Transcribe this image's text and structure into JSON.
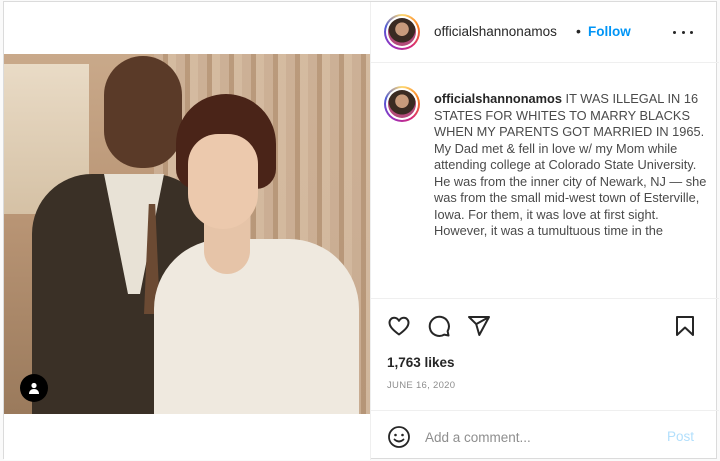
{
  "post": {
    "username": "officialshannonamos",
    "separator": "•",
    "follow_label": "Follow",
    "more_icon": "more-horizontal-icon",
    "caption_username": "officialshannonamos",
    "caption_text": " IT WAS ILLEGAL IN 16 STATES FOR WHITES TO MARRY BLACKS WHEN MY PARENTS GOT MARRIED IN 1965.",
    "caption_paragraph": "My Dad met & fell in love w/ my Mom while attending college at Colorado State University. He was from the inner city of Newark, NJ — she was from the small mid-west town of Esterville, Iowa. For them, it was love at first sight. However, it was a tumultuous time in the",
    "likes": "1,763 likes",
    "date": "JUNE 16, 2020",
    "comment_placeholder": "Add a comment...",
    "post_label": "Post"
  },
  "icons": {
    "like": "heart-icon",
    "comment": "comment-icon",
    "share": "share-icon",
    "save": "bookmark-icon",
    "emoji": "emoji-icon",
    "tagged": "user-tag-icon"
  },
  "colors": {
    "follow": "#0095f6",
    "post_disabled": "#b2dffc",
    "secondary_text": "#8e8e8e"
  }
}
